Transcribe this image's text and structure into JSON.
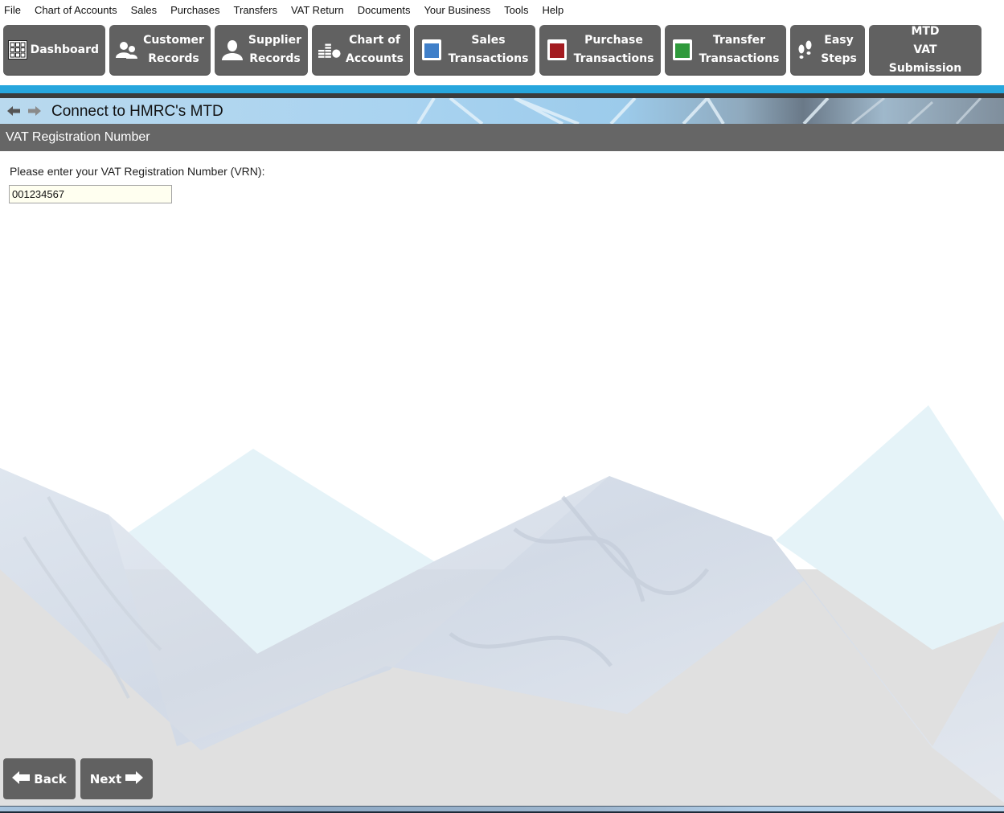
{
  "menu": [
    "File",
    "Chart of Accounts",
    "Sales",
    "Purchases",
    "Transfers",
    "VAT Return",
    "Documents",
    "Your Business",
    "Tools",
    "Help"
  ],
  "toolbar": [
    {
      "id": "dashboard",
      "label": "Dashboard",
      "icon": "grid-icon"
    },
    {
      "id": "customer-records",
      "label": "Customer Records",
      "line1": "Customer",
      "line2": "Records",
      "icon": "users-icon"
    },
    {
      "id": "supplier-records",
      "label": "Supplier Records",
      "line1": "Supplier",
      "line2": "Records",
      "icon": "user-icon"
    },
    {
      "id": "chart-of-accounts",
      "label": "Chart of Accounts",
      "line1": "Chart of",
      "line2": "Accounts",
      "icon": "coins-icon"
    },
    {
      "id": "sales-transactions",
      "label": "Sales Transactions",
      "line1": "Sales",
      "line2": "Transactions",
      "icon": "book-icon",
      "color": "#3f7fc9"
    },
    {
      "id": "purchase-transactions",
      "label": "Purchase Transactions",
      "line1": "Purchase",
      "line2": "Transactions",
      "icon": "book-icon",
      "color": "#a31b20"
    },
    {
      "id": "transfer-transactions",
      "label": "Transfer Transactions",
      "line1": "Transfer",
      "line2": "Transactions",
      "icon": "book-icon",
      "color": "#2f9a3c"
    },
    {
      "id": "easy-steps",
      "label": "Easy Steps",
      "line1": "Easy",
      "line2": "Steps",
      "icon": "footsteps-icon"
    },
    {
      "id": "mtd-vat-submission",
      "label": "MTD VAT Submission",
      "line1": "MTD",
      "line2": "VAT Submission"
    }
  ],
  "header": {
    "title": "Connect to HMRC's MTD"
  },
  "section": {
    "title": "VAT Registration Number"
  },
  "form": {
    "label": "Please enter your VAT Registration Number (VRN):",
    "vrn_value": "001234567"
  },
  "buttons": {
    "back": "Back",
    "next": "Next"
  },
  "colors": {
    "accent": "#27a6dd",
    "button_bg": "#616161",
    "section_bar": "#666666",
    "input_bg": "#fffff0"
  }
}
